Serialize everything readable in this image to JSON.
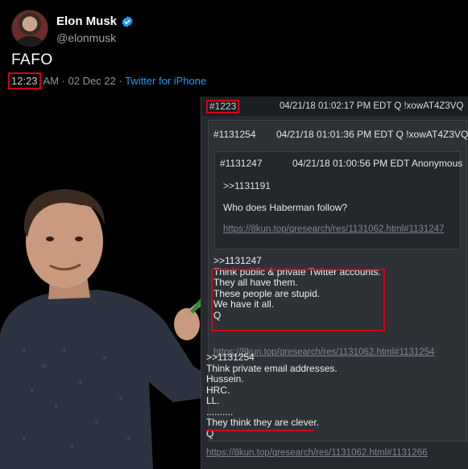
{
  "tweet": {
    "name": "Elon Musk",
    "handle": "@elonmusk",
    "text": "FAFO",
    "time": "12:23",
    "date_rest": " AM · 02 Dec 22 · ",
    "source": "Twitter for iPhone",
    "verified_color": "#1d9bf0"
  },
  "qdrop": {
    "id": "#1223",
    "meta": "04/21/18 01:02:17 PM EDT Q !xowAT4Z3VQ",
    "lines": [
      "Think private email addresses.",
      "Hussein.",
      "HRC.",
      "LL.",
      "..........",
      "They think they are clever.",
      "Q"
    ],
    "ref": ">>1131254",
    "link": "https://8kun.top/qresearch/res/1131062.html#1131266",
    "post2": {
      "id": "#1131254",
      "meta": "04/21/18 01:01:36 PM EDT Q !xowAT4Z3VQ",
      "ref": ">>1131247",
      "lines": [
        "Think public & private Twitter accounts.",
        "They all have them.",
        "These people are stupid.",
        "We have it all.",
        "Q"
      ],
      "link": "https://8kun.top/qresearch/res/1131062.html#1131254",
      "post3": {
        "id": "#1131247",
        "meta": "04/21/18 01:00:56 PM EDT Anonymous",
        "ref": ">>1131191",
        "question": "Who does Haberman follow?",
        "link": "https://8kun.top/qresearch/res/1131062.html#1131247"
      }
    }
  },
  "colors": {
    "highlight": "#d0021b",
    "link": "#1d9bf0"
  }
}
